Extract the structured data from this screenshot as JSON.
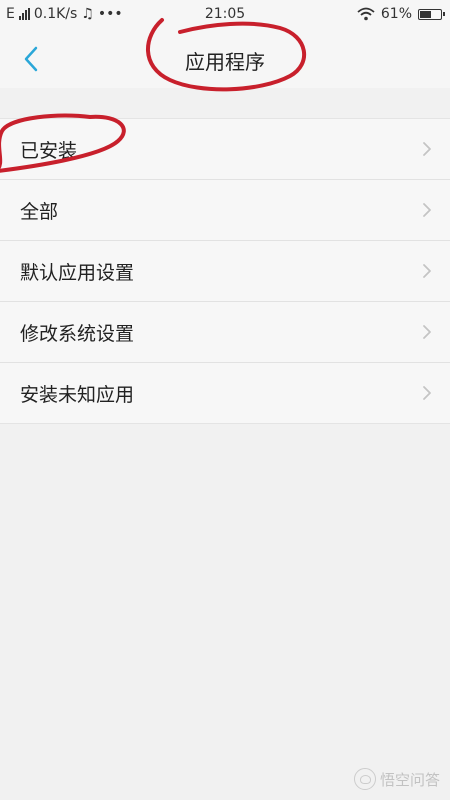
{
  "status_bar": {
    "network_type": "E",
    "speed": "0.1K/s",
    "music_icon": "♫",
    "more": "•••",
    "time": "21:05",
    "battery_text": "61%",
    "battery_level": 0.61
  },
  "header": {
    "back_icon": "chevron-left",
    "title": "应用程序"
  },
  "menu": {
    "items": [
      {
        "label": "已安装"
      },
      {
        "label": "全部"
      },
      {
        "label": "默认应用设置"
      },
      {
        "label": "修改系统设置"
      },
      {
        "label": "安装未知应用"
      }
    ]
  },
  "annotations": {
    "circle_color": "#c8202c"
  },
  "watermark": {
    "text": "悟空问答"
  },
  "colors": {
    "accent": "#2aa7d8",
    "background": "#f1f1f1",
    "chevron": "#c4c4c4"
  }
}
